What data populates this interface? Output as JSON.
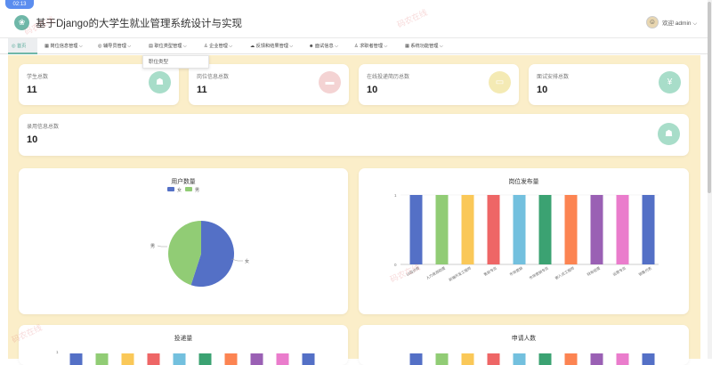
{
  "header": {
    "clock": "02:13",
    "title": "基于Django的大学生就业管理系统设计与实现",
    "user": "欢迎 admin ⌵",
    "logo": "logo-icon"
  },
  "nav": {
    "items": [
      {
        "label": "◎ 首页",
        "active": true
      },
      {
        "label": "▦ 岗位信息管理  ⌵"
      },
      {
        "label": "◎ 辅导员管理  ⌵"
      },
      {
        "label": "▤ 职位类型管理  ⌵"
      },
      {
        "label": "♙ 企业管理  ⌵"
      },
      {
        "label": "☁ 反馈和结果管理  ⌵"
      },
      {
        "label": "☻ 面试信息  ⌵"
      },
      {
        "label": "♙ 求职者管理  ⌵"
      },
      {
        "label": "▦ 系统功能管理  ⌵"
      }
    ],
    "dropdown_item": "职位类型"
  },
  "stats": [
    {
      "label": "学生总数",
      "value": "11",
      "color": "#a8ddc9",
      "icon": "people-icon"
    },
    {
      "label": "岗位信息总数",
      "value": "11",
      "color": "#f4d3d3",
      "icon": "briefcase-icon"
    },
    {
      "label": "在线投递简历总数",
      "value": "10",
      "color": "#f4eab4",
      "icon": "resume-icon"
    },
    {
      "label": "面试安排总数",
      "value": "10",
      "color": "#a8ddc9",
      "icon": "yen-icon"
    },
    {
      "label": "录用信息总数",
      "value": "10",
      "color": "#a8ddc9",
      "icon": "people-icon"
    }
  ],
  "watermarks": [
    "码农在线",
    "码农在线",
    "码农在线",
    "码农在线"
  ],
  "charts": {
    "pie": {
      "title": "用户数量",
      "legend": [
        "女",
        "男"
      ],
      "labels": [
        "男",
        "女"
      ]
    },
    "bar": {
      "title": "岗位发布量",
      "tick_y": [
        "1",
        "0"
      ]
    },
    "bottom_left": {
      "title": "投递量",
      "tick": "1"
    },
    "bottom_right": {
      "title": "申请人数"
    }
  },
  "chart_data": [
    {
      "type": "pie",
      "title": "用户数量",
      "categories": [
        "女",
        "男"
      ],
      "values": [
        55,
        45
      ],
      "colors": [
        "#5470c6",
        "#91cc75"
      ]
    },
    {
      "type": "bar",
      "title": "岗位发布量",
      "categories": [
        "UI设计师",
        "人力资源助理",
        "前端开发工程师",
        "售前专员",
        "市场营销",
        "市场营销专员",
        "嵌入式工程师",
        "财务经理",
        "运营专员",
        "销售代表"
      ],
      "values": [
        1,
        1,
        1,
        1,
        1,
        1,
        1,
        1,
        1,
        1
      ],
      "ylim": [
        0,
        1
      ],
      "colors": [
        "#5470c6",
        "#91cc75",
        "#fac858",
        "#ee6666",
        "#73c0de",
        "#3ba272",
        "#fc8452",
        "#9a60b4",
        "#ea7ccc",
        "#5470c6"
      ]
    },
    {
      "type": "bar",
      "title": "投递量",
      "values": [
        1,
        1,
        1,
        1,
        1,
        1,
        1,
        1,
        1,
        1
      ],
      "colors": [
        "#5470c6",
        "#91cc75",
        "#fac858",
        "#ee6666",
        "#73c0de",
        "#3ba272",
        "#fc8452",
        "#9a60b4",
        "#ea7ccc",
        "#5470c6"
      ]
    },
    {
      "type": "bar",
      "title": "申请人数",
      "values": [
        1,
        1,
        1,
        1,
        1,
        1,
        1,
        1,
        1,
        1
      ],
      "colors": [
        "#5470c6",
        "#91cc75",
        "#fac858",
        "#ee6666",
        "#73c0de",
        "#3ba272",
        "#fc8452",
        "#9a60b4",
        "#ea7ccc",
        "#5470c6"
      ]
    }
  ]
}
